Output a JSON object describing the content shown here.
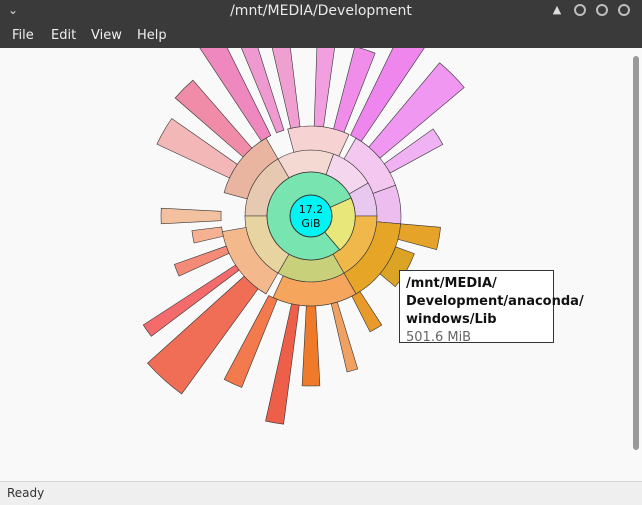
{
  "window": {
    "title": "/mnt/MEDIA/Development"
  },
  "menu": {
    "file": "File",
    "edit": "Edit",
    "view": "View",
    "help": "Help"
  },
  "center": {
    "line1": "17.2",
    "line2": "GiB"
  },
  "tooltip": {
    "path_line1": "/mnt/MEDIA/",
    "path_line2": "Development/anaconda/",
    "path_line3": "windows/Lib",
    "size": "501.6 MiB"
  },
  "status": {
    "text": "Ready"
  },
  "colors": {
    "center": "#00f4f4",
    "titlebar": "#3a3a3a",
    "accent": "#e38a1f"
  },
  "icons": {
    "window_menu": "chevron-down-icon",
    "maximize": "chevron-up-icon"
  }
}
